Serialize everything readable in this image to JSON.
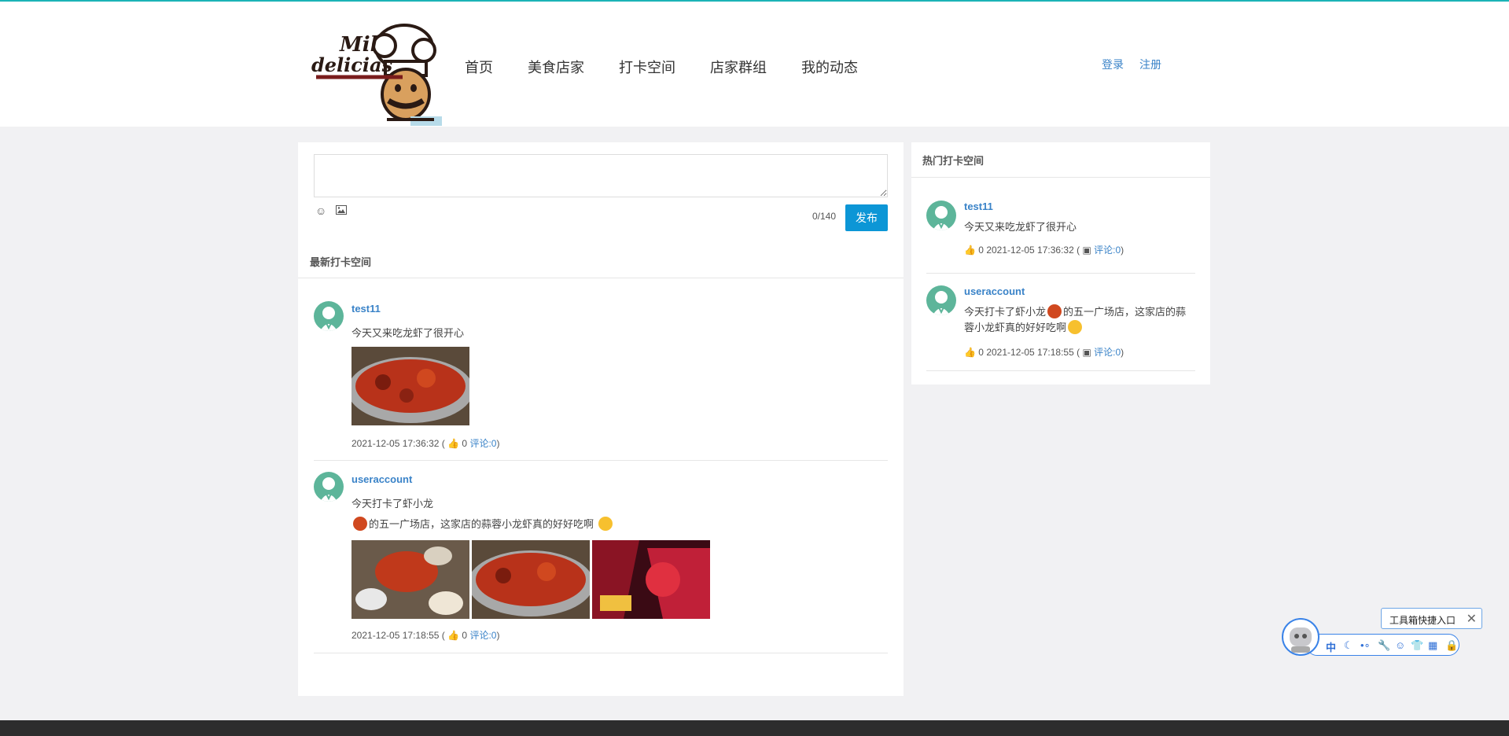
{
  "nav": {
    "items": [
      "首页",
      "美食店家",
      "打卡空间",
      "店家群组",
      "我的动态"
    ],
    "login": "登录",
    "register": "注册"
  },
  "logo": {
    "text_top": "Mil",
    "text_bottom": "delicias"
  },
  "composer": {
    "counter": "0/140",
    "publish": "发布"
  },
  "latest": {
    "title": "最新打卡空间",
    "posts": [
      {
        "user": "test11",
        "text": "今天又来吃龙虾了很开心",
        "time": "2021-12-05 17:36:32",
        "likes": "0",
        "comments": "评论:0"
      },
      {
        "user": "useraccount",
        "text_line1": "今天打卡了虾小龙",
        "text_line2": "的五一广场店，这家店的蒜蓉小龙虾真的好好吃啊",
        "time": "2021-12-05 17:18:55",
        "likes": "0",
        "comments": "评论:0"
      }
    ]
  },
  "hot": {
    "title": "热门打卡空间",
    "posts": [
      {
        "user": "test11",
        "text": "今天又来吃龙虾了很开心",
        "likes": "0",
        "time": "2021-12-05 17:36:32",
        "comments": "评论:0"
      },
      {
        "user": "useraccount",
        "text_a": "今天打卡了虾小龙",
        "text_b": "的五一广场店，这家店的蒜蓉小龙虾真的好好吃啊",
        "likes": "0",
        "time": "2021-12-05 17:18:55",
        "comments": "评论:0"
      }
    ]
  },
  "toolbox": {
    "tip": "工具箱快捷入口",
    "lang": "中"
  },
  "colors": {
    "accent": "#0c96d6",
    "link": "#3a83c8",
    "avatar": "#5db59a",
    "topline": "#1bb3b6"
  }
}
